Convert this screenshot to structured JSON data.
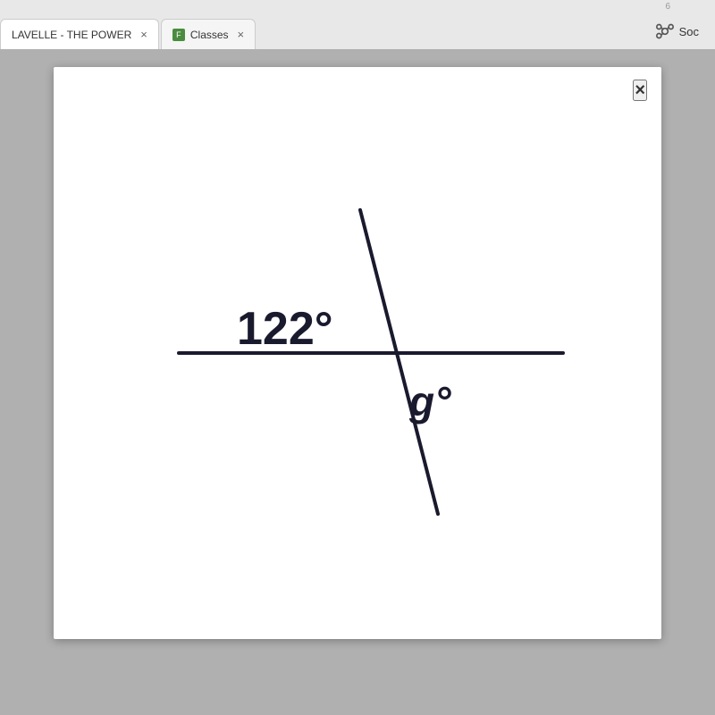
{
  "browser": {
    "tab_number": "6",
    "tabs": [
      {
        "id": "tab-1",
        "label": "LAVELLE - THE POWER",
        "active": true,
        "has_close": true,
        "favicon": null
      },
      {
        "id": "tab-2",
        "label": "Classes",
        "active": false,
        "has_close": true,
        "favicon": "classes"
      }
    ],
    "soc_label": "Soc"
  },
  "modal": {
    "close_label": "×",
    "diagram": {
      "angle1_value": "122",
      "angle1_degree": "°",
      "angle2_value": "g",
      "angle2_degree": "°"
    }
  }
}
